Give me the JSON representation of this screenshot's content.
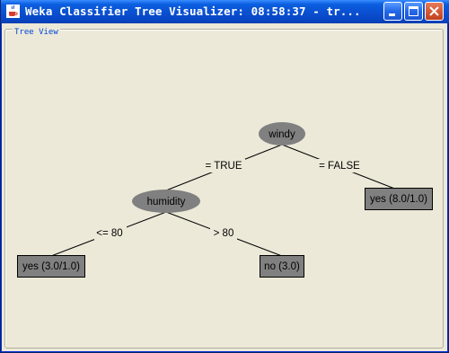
{
  "window": {
    "title": "Weka Classifier Tree Visualizer: 08:58:37 - tr..."
  },
  "panel": {
    "title": "Tree View"
  },
  "tree": {
    "nodes": [
      {
        "id": "n0",
        "label": "windy",
        "kind": "decision"
      },
      {
        "id": "n1",
        "label": "humidity",
        "kind": "decision"
      },
      {
        "id": "n2",
        "label": "yes (8.0/1.0)",
        "kind": "leaf"
      },
      {
        "id": "n3",
        "label": "yes (3.0/1.0)",
        "kind": "leaf"
      },
      {
        "id": "n4",
        "label": "no (3.0)",
        "kind": "leaf"
      }
    ],
    "edges": [
      {
        "from": "n0",
        "to": "n1",
        "label": "= TRUE"
      },
      {
        "from": "n0",
        "to": "n2",
        "label": "= FALSE"
      },
      {
        "from": "n1",
        "to": "n3",
        "label": "<= 80"
      },
      {
        "from": "n1",
        "to": "n4",
        "label": "> 80"
      }
    ]
  },
  "colors": {
    "node_fill": "#808080",
    "node_text": "#000000",
    "edge": "#000000"
  }
}
